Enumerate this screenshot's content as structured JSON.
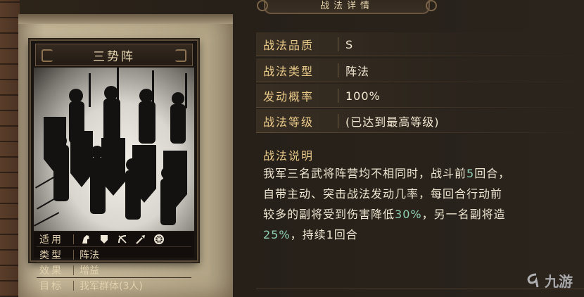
{
  "header": {
    "banner_text": "战法详情"
  },
  "card": {
    "name": "三势阵",
    "stats": [
      {
        "key": "适用",
        "value": ""
      },
      {
        "key": "类型",
        "value": "阵法"
      },
      {
        "key": "效果",
        "value": "增益"
      },
      {
        "key": "目标",
        "value": "我军群体(3人)"
      }
    ],
    "unit_icons": [
      "cavalry-icon",
      "shield-infantry-icon",
      "archer-icon",
      "spear-icon",
      "siege-wheel-icon"
    ]
  },
  "details": [
    {
      "label": "战法品质",
      "value": "S"
    },
    {
      "label": "战法类型",
      "value": "阵法"
    },
    {
      "label": "发动概率",
      "value": "100%"
    },
    {
      "label": "战法等级",
      "value": "(已达到最高等级)"
    }
  ],
  "description": {
    "label": "战法说明",
    "line1": "我军三名武将阵营均不相同时，战斗前",
    "line1_num": "5",
    "line1_end": "回合，",
    "line2": "自带主动、突击战法发动几率，每回合行动前",
    "line3_pre": "较多的副将受到伤害降低",
    "line3_pct": "30%",
    "line3_post": "，另一名副将造",
    "line4_pct": "25%",
    "line4_post": "，持续1回合"
  },
  "watermark": {
    "text": "九游"
  },
  "colors": {
    "label_gold": "#e8c98a",
    "value_cream": "#f1e7d2",
    "highlight_green": "#8fd0b2"
  }
}
